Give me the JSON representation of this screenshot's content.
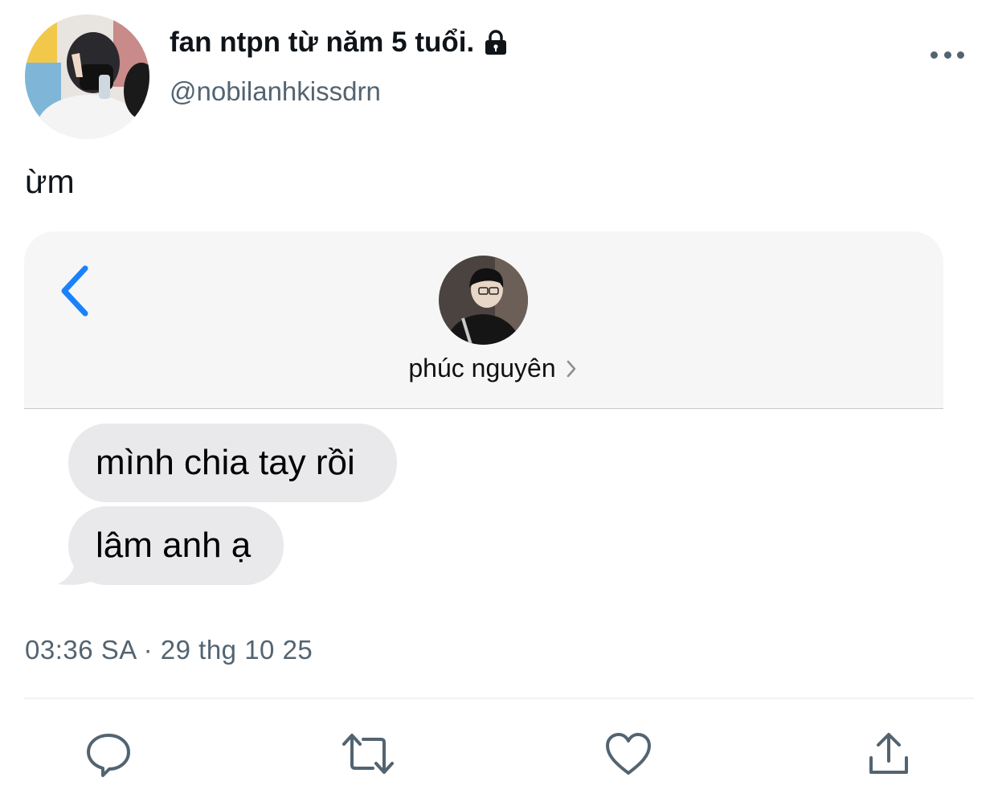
{
  "tweet": {
    "display_name": "fan ntpn từ năm 5 tuổi.",
    "handle": "@nobilanhkissdrn",
    "text": "ừm",
    "timestamp": "03:36 SA · 29 thg 10 25"
  },
  "icons": {
    "lock": "lock-icon",
    "more": "more-options-icon",
    "reply": "reply-icon",
    "retweet": "retweet-icon",
    "like": "heart-icon",
    "share": "share-icon"
  },
  "screenshot": {
    "contact_name": "phúc nguyên",
    "messages": [
      "mình chia tay rồi",
      "lâm anh ạ"
    ],
    "accent_color": "#1a82fb"
  }
}
